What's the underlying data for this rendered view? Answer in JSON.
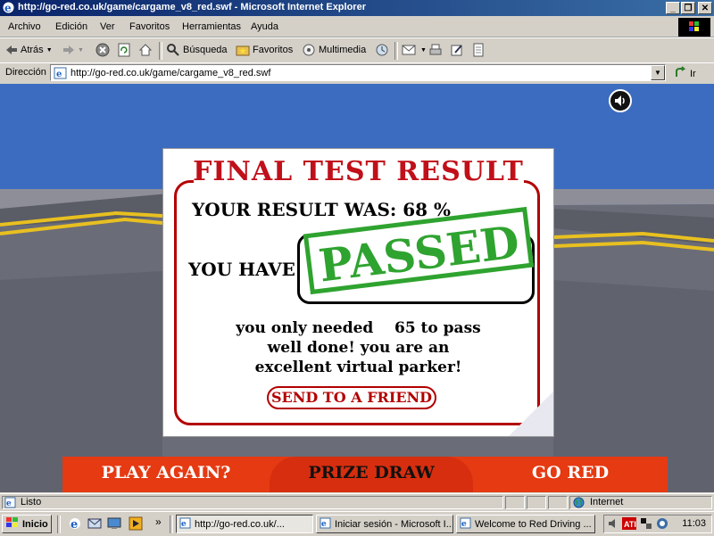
{
  "window": {
    "title": "http://go-red.co.uk/game/cargame_v8_red.swf - Microsoft Internet Explorer",
    "minimize": "_",
    "restore": "❐",
    "close": "✕"
  },
  "menu": [
    "Archivo",
    "Edición",
    "Ver",
    "Favoritos",
    "Herramientas",
    "Ayuda"
  ],
  "toolbar": {
    "back": "Atrás",
    "search": "Búsqueda",
    "favorites": "Favoritos",
    "multimedia": "Multimedia"
  },
  "address": {
    "label": "Dirección",
    "url": "http://go-red.co.uk/game/cargame_v8_red.swf",
    "go": "Ir"
  },
  "game": {
    "title": "FINAL TEST RESULT",
    "result_line": "YOUR RESULT WAS: 68 %",
    "you_have": "YOU HAVE",
    "stamp": "PASSED",
    "msg_line1": "you only needed    65 to pass",
    "msg_line2": "well done! you are an",
    "msg_line3": "excellent virtual parker!",
    "send_button": "SEND TO A FRIEND",
    "nav": [
      "PLAY AGAIN?",
      "PRIZE DRAW",
      "GO RED"
    ]
  },
  "status": {
    "text": "Listo",
    "zone": "Internet"
  },
  "taskbar": {
    "start": "Inicio",
    "tasks": [
      "http://go-red.co.uk/...",
      "Iniciar sesión - Microsoft I...",
      "Welcome to Red Driving ..."
    ],
    "clock": "11:03"
  },
  "colors": {
    "accent_red": "#c0101a",
    "stamp_green": "#2fa32f",
    "nav_orange": "#e53a12"
  }
}
